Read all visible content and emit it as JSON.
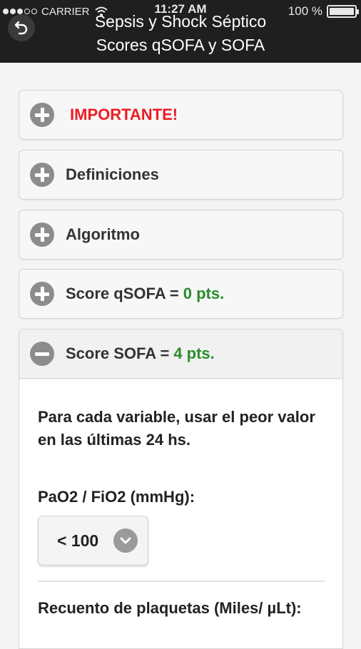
{
  "status_bar": {
    "carrier": "CARRIER",
    "time": "11:27 AM",
    "battery": "100 %",
    "signal_bars_filled": 3,
    "signal_bars_total": 5
  },
  "header": {
    "title_line1": "Sepsis y Shock Séptico",
    "title_line2": "Scores qSOFA y SOFA",
    "back_icon": "back-arrow-icon"
  },
  "accordion": [
    {
      "label": "IMPORTANTE!",
      "points": "",
      "expanded": false,
      "icon": "plus-circle-icon"
    },
    {
      "label": "Definiciones",
      "points": "",
      "expanded": false,
      "icon": "plus-circle-icon"
    },
    {
      "label": "Algoritmo",
      "points": "",
      "expanded": false,
      "icon": "plus-circle-icon"
    },
    {
      "label": "Score qSOFA =",
      "points": "0 pts.",
      "expanded": false,
      "icon": "plus-circle-icon"
    },
    {
      "label": "Score SOFA =",
      "points": "4 pts.",
      "expanded": true,
      "icon": "minus-circle-icon"
    }
  ],
  "sofa_panel": {
    "instruction": "Para cada variable, usar el peor valor en las últimas 24 hs.",
    "pao2_label": "PaO2 / FiO2 (mmHg):",
    "pao2_value": "< 100",
    "platelets_label": "Recuento de plaquetas (Miles/ µLt):"
  },
  "colors": {
    "header_bg": "#1f1f1f",
    "alert": "#ee1c24",
    "points": "#2a8c2a",
    "icon_gray": "#8c8c8c"
  }
}
